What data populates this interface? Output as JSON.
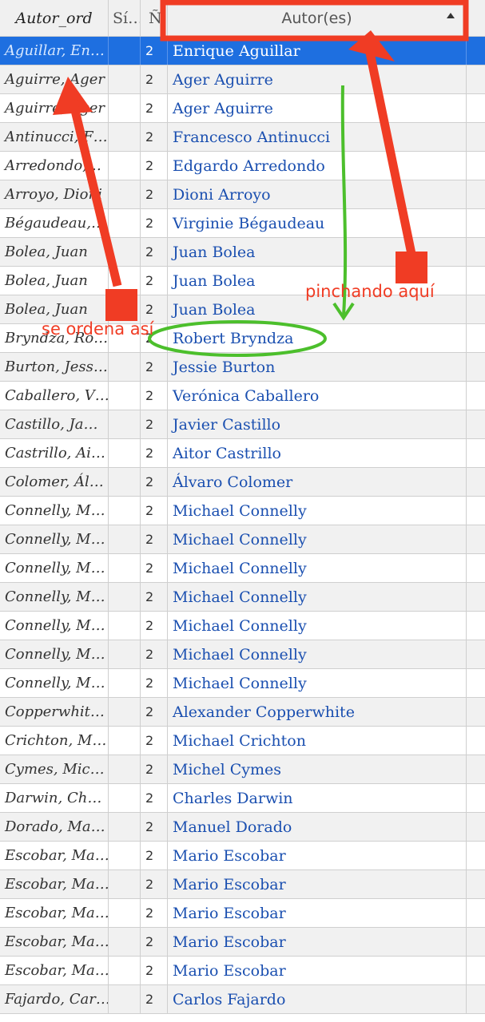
{
  "header": {
    "autor_ord": "Autor_ord",
    "si": "Sí…",
    "n": "Ñ",
    "autor": "Autor(es)"
  },
  "annotations": {
    "click_here": "pinchando aquí",
    "sorted_like_this": "se ordena así"
  },
  "colors": {
    "annotation_red": "#f03c24",
    "annotation_green": "#4cbf2c",
    "selected_row": "#1e6fe0",
    "author_link": "#1a4fb0"
  },
  "rows": [
    {
      "ord": "Aguillar, En…",
      "n": "2",
      "autor": "Enrique Aguillar",
      "selected": true
    },
    {
      "ord": "Aguirre, Ager",
      "n": "2",
      "autor": "Ager Aguirre"
    },
    {
      "ord": "Aguirre, Ager",
      "n": "2",
      "autor": "Ager Aguirre"
    },
    {
      "ord": "Antinucci, F…",
      "n": "2",
      "autor": "Francesco Antinucci"
    },
    {
      "ord": "Arredondo,…",
      "n": "2",
      "autor": "Edgardo Arredondo"
    },
    {
      "ord": "Arroyo, Dioni",
      "n": "2",
      "autor": "Dioni Arroyo"
    },
    {
      "ord": "Bégaudeau,…",
      "n": "2",
      "autor": "Virginie Bégaudeau"
    },
    {
      "ord": "Bolea, Juan",
      "n": "2",
      "autor": "Juan Bolea"
    },
    {
      "ord": "Bolea, Juan",
      "n": "2",
      "autor": "Juan Bolea"
    },
    {
      "ord": "Bolea, Juan",
      "n": "2",
      "autor": "Juan Bolea"
    },
    {
      "ord": "Bryndza, Ro…",
      "n": "2",
      "autor": "Robert Bryndza"
    },
    {
      "ord": "Burton, Jess…",
      "n": "2",
      "autor": "Jessie Burton"
    },
    {
      "ord": "Caballero, V…",
      "n": "2",
      "autor": "Verónica Caballero"
    },
    {
      "ord": "Castillo, Ja…",
      "n": "2",
      "autor": "Javier Castillo"
    },
    {
      "ord": "Castrillo, Ai…",
      "n": "2",
      "autor": "Aitor Castrillo"
    },
    {
      "ord": "Colomer, Ál…",
      "n": "2",
      "autor": "Álvaro Colomer"
    },
    {
      "ord": "Connelly, M…",
      "n": "2",
      "autor": "Michael Connelly"
    },
    {
      "ord": "Connelly, M…",
      "n": "2",
      "autor": "Michael Connelly"
    },
    {
      "ord": "Connelly, M…",
      "n": "2",
      "autor": "Michael Connelly"
    },
    {
      "ord": "Connelly, M…",
      "n": "2",
      "autor": "Michael Connelly"
    },
    {
      "ord": "Connelly, M…",
      "n": "2",
      "autor": "Michael Connelly"
    },
    {
      "ord": "Connelly, M…",
      "n": "2",
      "autor": "Michael Connelly"
    },
    {
      "ord": "Connelly, M…",
      "n": "2",
      "autor": "Michael Connelly"
    },
    {
      "ord": "Copperwhit…",
      "n": "2",
      "autor": "Alexander Copperwhite"
    },
    {
      "ord": "Crichton, M…",
      "n": "2",
      "autor": "Michael Crichton"
    },
    {
      "ord": "Cymes, Mic…",
      "n": "2",
      "autor": "Michel Cymes"
    },
    {
      "ord": "Darwin, Ch…",
      "n": "2",
      "autor": "Charles Darwin"
    },
    {
      "ord": "Dorado, Ma…",
      "n": "2",
      "autor": "Manuel Dorado"
    },
    {
      "ord": "Escobar, Ma…",
      "n": "2",
      "autor": "Mario Escobar"
    },
    {
      "ord": "Escobar, Ma…",
      "n": "2",
      "autor": "Mario Escobar"
    },
    {
      "ord": "Escobar, Ma…",
      "n": "2",
      "autor": "Mario Escobar"
    },
    {
      "ord": "Escobar, Ma…",
      "n": "2",
      "autor": "Mario Escobar"
    },
    {
      "ord": "Escobar, Ma…",
      "n": "2",
      "autor": "Mario Escobar"
    },
    {
      "ord": "Fajardo, Car…",
      "n": "2",
      "autor": "Carlos Fajardo"
    }
  ]
}
